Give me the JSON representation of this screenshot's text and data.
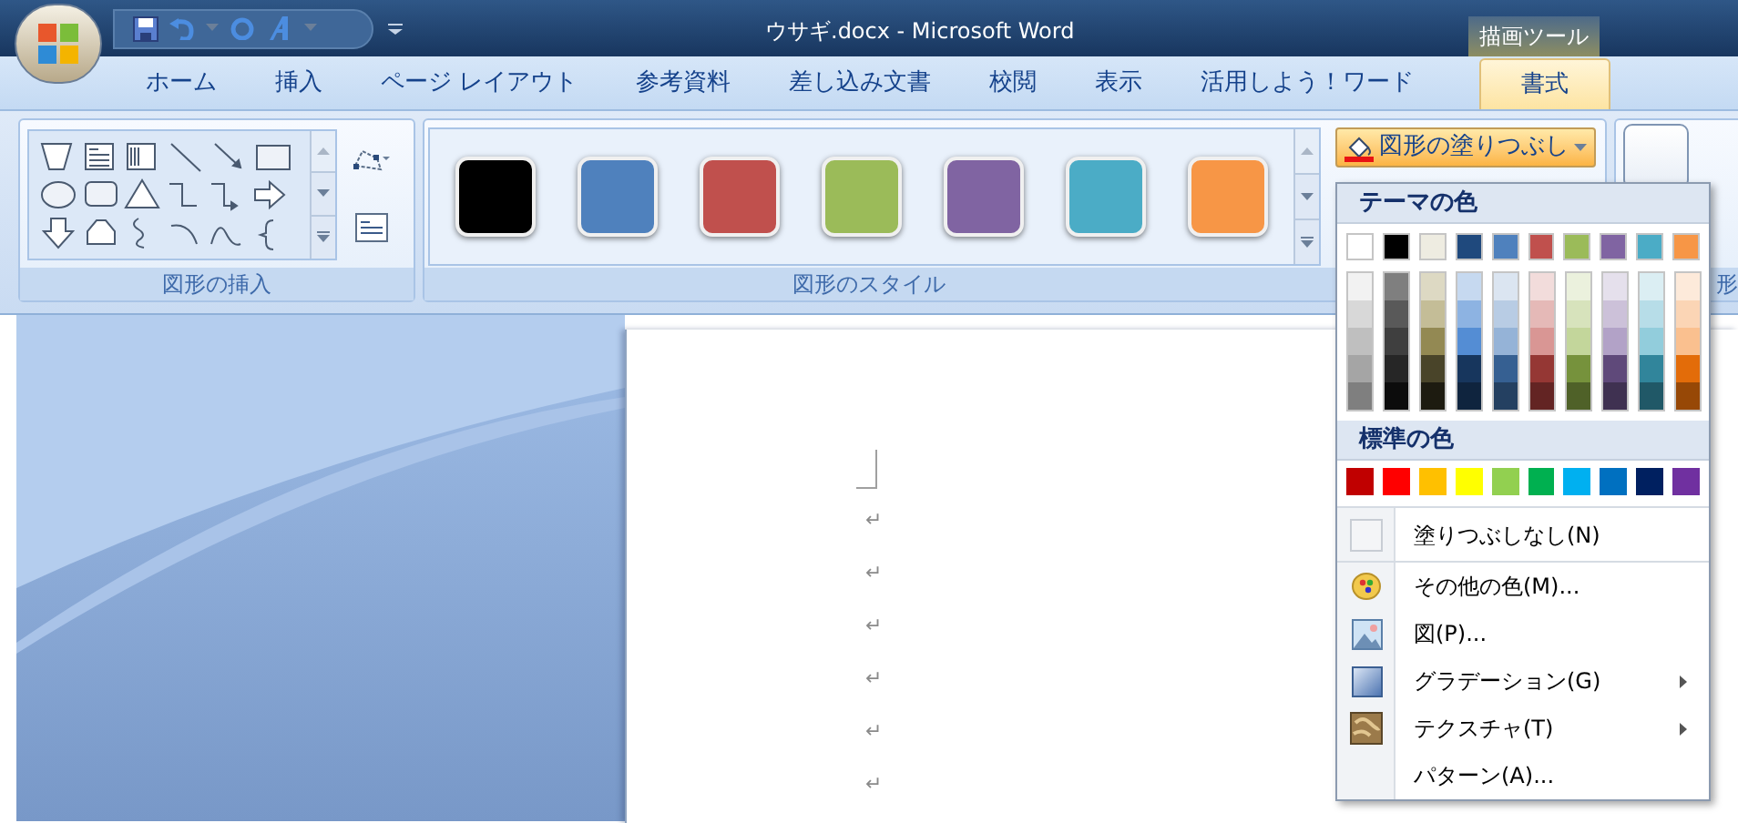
{
  "window": {
    "title": "ウサギ.docx - Microsoft Word"
  },
  "context_tab_group": "描画ツール",
  "tabs": [
    {
      "label": "ホーム",
      "selected": false
    },
    {
      "label": "挿入",
      "selected": false
    },
    {
      "label": "ページ レイアウト",
      "selected": false
    },
    {
      "label": "参考資料",
      "selected": false
    },
    {
      "label": "差し込み文書",
      "selected": false
    },
    {
      "label": "校閲",
      "selected": false
    },
    {
      "label": "表示",
      "selected": false
    },
    {
      "label": "活用しよう！ワード",
      "selected": false
    },
    {
      "label": "書式",
      "selected": true
    }
  ],
  "insert_shapes": {
    "label": "図形の挿入"
  },
  "shape_styles": {
    "label": "図形のスタイル",
    "swatches": [
      {
        "color": "#000000"
      },
      {
        "color": "#4f81bd"
      },
      {
        "color": "#c0504d"
      },
      {
        "color": "#9bbb59"
      },
      {
        "color": "#8064a2"
      },
      {
        "color": "#4bacc6"
      },
      {
        "color": "#f79646"
      }
    ]
  },
  "fill_button": {
    "label": "図形の塗りつぶし",
    "open": true
  },
  "next_group": {
    "label": "形"
  },
  "fill_menu": {
    "theme_heading": "テーマの色",
    "theme_colors": [
      {
        "color": "#ffffff",
        "shades": [
          {
            "color": "#f2f2f2"
          },
          {
            "color": "#d8d8d8"
          },
          {
            "color": "#bfbfbf"
          },
          {
            "color": "#a5a5a5"
          },
          {
            "color": "#7f7f7f"
          }
        ]
      },
      {
        "color": "#000000",
        "shades": [
          {
            "color": "#7f7f7f"
          },
          {
            "color": "#595959"
          },
          {
            "color": "#3f3f3f"
          },
          {
            "color": "#262626"
          },
          {
            "color": "#0c0c0c"
          }
        ]
      },
      {
        "color": "#eeece1",
        "shades": [
          {
            "color": "#ddd9c3"
          },
          {
            "color": "#c4bd97"
          },
          {
            "color": "#938953"
          },
          {
            "color": "#494429"
          },
          {
            "color": "#1d1b10"
          }
        ]
      },
      {
        "color": "#1f497d",
        "shades": [
          {
            "color": "#c6d9f0"
          },
          {
            "color": "#8db3e2"
          },
          {
            "color": "#548dd4"
          },
          {
            "color": "#17365d"
          },
          {
            "color": "#0f243e"
          }
        ]
      },
      {
        "color": "#4f81bd",
        "shades": [
          {
            "color": "#dbe5f1"
          },
          {
            "color": "#b8cce4"
          },
          {
            "color": "#95b3d7"
          },
          {
            "color": "#366092"
          },
          {
            "color": "#244061"
          }
        ]
      },
      {
        "color": "#c0504d",
        "shades": [
          {
            "color": "#f2dcdb"
          },
          {
            "color": "#e5b9b7"
          },
          {
            "color": "#d99694"
          },
          {
            "color": "#953734"
          },
          {
            "color": "#632423"
          }
        ]
      },
      {
        "color": "#9bbb59",
        "shades": [
          {
            "color": "#ebf1dd"
          },
          {
            "color": "#d7e3bc"
          },
          {
            "color": "#c3d69b"
          },
          {
            "color": "#76923c"
          },
          {
            "color": "#4f6128"
          }
        ]
      },
      {
        "color": "#8064a2",
        "shades": [
          {
            "color": "#e5e0ec"
          },
          {
            "color": "#ccc1d9"
          },
          {
            "color": "#b2a2c7"
          },
          {
            "color": "#5f497a"
          },
          {
            "color": "#3f3151"
          }
        ]
      },
      {
        "color": "#4bacc6",
        "shades": [
          {
            "color": "#dbeef3"
          },
          {
            "color": "#b7dde8"
          },
          {
            "color": "#92cddc"
          },
          {
            "color": "#31859b"
          },
          {
            "color": "#205867"
          }
        ]
      },
      {
        "color": "#f79646",
        "shades": [
          {
            "color": "#fdeada"
          },
          {
            "color": "#fbd5b5"
          },
          {
            "color": "#fac08f"
          },
          {
            "color": "#e36c09"
          },
          {
            "color": "#974806"
          }
        ]
      }
    ],
    "standard_heading": "標準の色",
    "standard_colors": [
      {
        "color": "#c00000"
      },
      {
        "color": "#ff0000"
      },
      {
        "color": "#ffc000"
      },
      {
        "color": "#ffff00"
      },
      {
        "color": "#92d050"
      },
      {
        "color": "#00b050"
      },
      {
        "color": "#00b0f0"
      },
      {
        "color": "#0070c0"
      },
      {
        "color": "#002060"
      },
      {
        "color": "#7030a0"
      }
    ],
    "items": [
      {
        "kind": "no_fill",
        "label": "塗りつぶしなし(N)",
        "submenu": false
      },
      {
        "kind": "more_colors",
        "label": "その他の色(M)...",
        "submenu": false
      },
      {
        "kind": "picture",
        "label": "図(P)...",
        "submenu": false
      },
      {
        "kind": "gradient",
        "label": "グラデーション(G)",
        "submenu": true
      },
      {
        "kind": "texture",
        "label": "テクスチャ(T)",
        "submenu": true
      },
      {
        "kind": "pattern",
        "label": "パターン(A)...",
        "submenu": false
      }
    ]
  },
  "document": {
    "paragraph_marks": [
      "↵",
      "↵",
      "↵",
      "↵",
      "↵",
      "↵"
    ]
  }
}
